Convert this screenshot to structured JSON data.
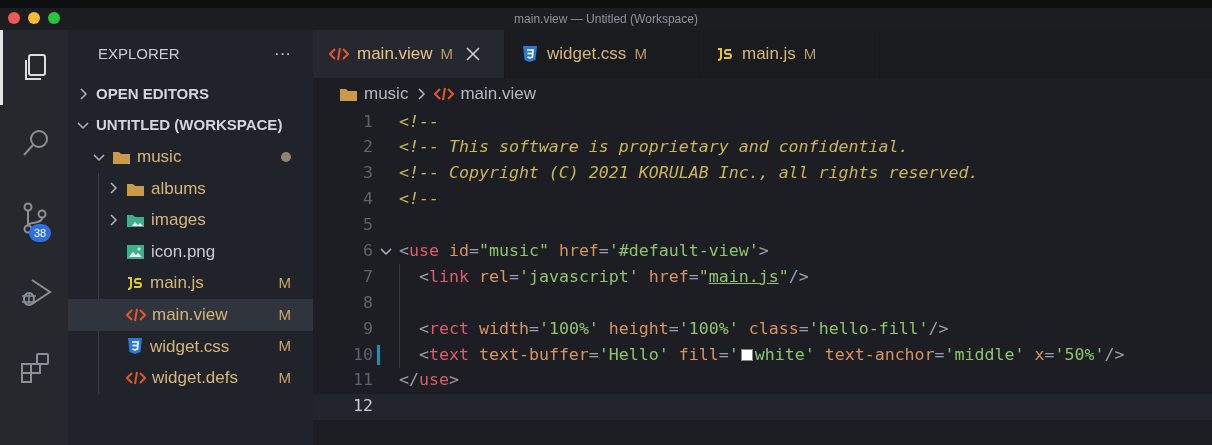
{
  "window": {
    "title": "main.view — Untitled (Workspace)"
  },
  "activity_bar": [
    {
      "kind": "explorer",
      "selected": true
    },
    {
      "kind": "search",
      "selected": false
    },
    {
      "kind": "source-control",
      "selected": false,
      "badge": "38"
    },
    {
      "kind": "run-debug",
      "selected": false
    },
    {
      "kind": "extensions",
      "selected": false
    }
  ],
  "sidebar": {
    "title": "EXPLORER",
    "more": "···",
    "sections": [
      {
        "label": "OPEN EDITORS",
        "expanded": false
      },
      {
        "label": "UNTITLED (WORKSPACE)",
        "expanded": true
      }
    ],
    "tree": [
      {
        "label": "music",
        "kind": "folder",
        "expanded": true,
        "selected": false,
        "modified": true,
        "children": [
          {
            "label": "albums",
            "kind": "folder",
            "expanded": false,
            "selected": false
          },
          {
            "label": "images",
            "kind": "folder-images",
            "expanded": false,
            "selected": false
          },
          {
            "label": "icon.png",
            "kind": "image",
            "selected": false
          },
          {
            "label": "main.js",
            "kind": "js",
            "status": "M",
            "selected": false
          },
          {
            "label": "main.view",
            "kind": "view",
            "status": "M",
            "selected": true
          },
          {
            "label": "widget.css",
            "kind": "css",
            "status": "M",
            "selected": false
          },
          {
            "label": "widget.defs",
            "kind": "view",
            "status": "M",
            "selected": false
          }
        ]
      }
    ]
  },
  "tabs": [
    {
      "label": "main.view",
      "kind": "view",
      "status": "M",
      "selected": true
    },
    {
      "label": "widget.css",
      "kind": "css",
      "status": "M",
      "selected": false
    },
    {
      "label": "main.js",
      "kind": "js",
      "status": "M",
      "selected": false
    }
  ],
  "breadcrumb": [
    {
      "label": "music",
      "kind": "folder"
    },
    {
      "label": "main.view",
      "kind": "view"
    }
  ],
  "editor": {
    "lines": [
      {
        "number": "1",
        "selected": false,
        "tokens": [
          {
            "kind": "comment",
            "text": "<!--"
          }
        ]
      },
      {
        "number": "2",
        "selected": false,
        "tokens": [
          {
            "kind": "comment",
            "text": "<!-- This software is proprietary and confidential."
          }
        ]
      },
      {
        "number": "3",
        "selected": false,
        "tokens": [
          {
            "kind": "comment",
            "text": "<!-- Copyright (C) 2021 KORULAB Inc., all rights reserved."
          }
        ]
      },
      {
        "number": "4",
        "selected": false,
        "tokens": [
          {
            "kind": "comment",
            "text": "<!--"
          }
        ]
      },
      {
        "number": "5",
        "selected": false
      },
      {
        "number": "6",
        "selected": false,
        "expanded": true,
        "tokens": [
          {
            "kind": "punct",
            "text": "<"
          },
          {
            "kind": "tag",
            "text": "use"
          },
          {
            "kind": "attr",
            "text": " id"
          },
          {
            "kind": "punct",
            "text": "="
          },
          {
            "kind": "string",
            "text": "\"music\""
          },
          {
            "kind": "attr",
            "text": " href"
          },
          {
            "kind": "punct",
            "text": "="
          },
          {
            "kind": "string",
            "text": "'#default-view'"
          },
          {
            "kind": "punct",
            "text": ">"
          }
        ]
      },
      {
        "number": "7",
        "selected": false,
        "indent_guide": true,
        "tokens": [
          {
            "kind": "punct",
            "text": "<"
          },
          {
            "kind": "tag",
            "text": "link"
          },
          {
            "kind": "attr",
            "text": " rel"
          },
          {
            "kind": "punct",
            "text": "="
          },
          {
            "kind": "string",
            "text": "'javascript'"
          },
          {
            "kind": "attr",
            "text": " href"
          },
          {
            "kind": "punct",
            "text": "="
          },
          {
            "kind": "string",
            "text": "\""
          },
          {
            "kind": "link",
            "text": "main.js"
          },
          {
            "kind": "string",
            "text": "\""
          },
          {
            "kind": "punct",
            "text": "/>"
          }
        ]
      },
      {
        "number": "8",
        "selected": false,
        "indent_guide": true
      },
      {
        "number": "9",
        "selected": false,
        "indent_guide": true,
        "tokens": [
          {
            "kind": "punct",
            "text": "<"
          },
          {
            "kind": "tag",
            "text": "rect"
          },
          {
            "kind": "attr",
            "text": " width"
          },
          {
            "kind": "punct",
            "text": "="
          },
          {
            "kind": "string",
            "text": "'100%'"
          },
          {
            "kind": "attr",
            "text": " height"
          },
          {
            "kind": "punct",
            "text": "="
          },
          {
            "kind": "string",
            "text": "'100%'"
          },
          {
            "kind": "attr",
            "text": " class"
          },
          {
            "kind": "punct",
            "text": "="
          },
          {
            "kind": "string",
            "text": "'hello-fill'"
          },
          {
            "kind": "punct",
            "text": "/>"
          }
        ]
      },
      {
        "number": "10",
        "selected": false,
        "indent_guide": true,
        "modified": true,
        "tokens": [
          {
            "kind": "punct",
            "text": "<"
          },
          {
            "kind": "tag",
            "text": "text"
          },
          {
            "kind": "attr",
            "text": " text-buffer"
          },
          {
            "kind": "punct",
            "text": "="
          },
          {
            "kind": "string",
            "text": "'Hello'"
          },
          {
            "kind": "attr",
            "text": " fill"
          },
          {
            "kind": "punct",
            "text": "="
          },
          {
            "kind": "string",
            "text": "'"
          },
          {
            "kind": "swatch",
            "color": "#ffffff"
          },
          {
            "kind": "string",
            "text": "white'"
          },
          {
            "kind": "attr",
            "text": " text-anchor"
          },
          {
            "kind": "punct",
            "text": "="
          },
          {
            "kind": "string",
            "text": "'middle'"
          },
          {
            "kind": "attr",
            "text": " x"
          },
          {
            "kind": "punct",
            "text": "="
          },
          {
            "kind": "string",
            "text": "'50%'"
          },
          {
            "kind": "punct",
            "text": "/>"
          }
        ]
      },
      {
        "number": "11",
        "selected": false,
        "tokens": [
          {
            "kind": "punct",
            "text": "</"
          },
          {
            "kind": "tag",
            "text": "use"
          },
          {
            "kind": "punct",
            "text": ">"
          }
        ]
      },
      {
        "number": "12",
        "selected": true
      }
    ]
  }
}
